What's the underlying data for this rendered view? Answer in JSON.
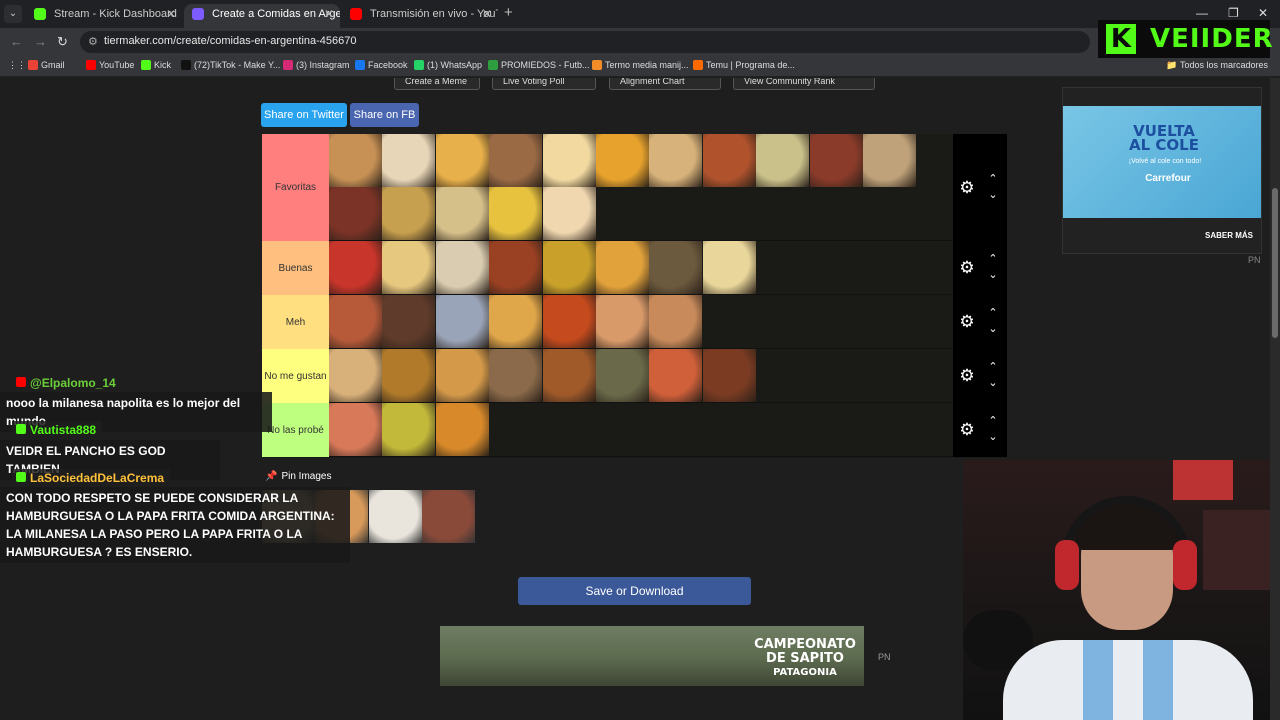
{
  "browser": {
    "tabs": [
      {
        "title": "Stream - Kick Dashboard",
        "color": "#53fc18"
      },
      {
        "title": "Create a Comidas en Argentina",
        "color": "#7c5cff"
      },
      {
        "title": "Transmisión en vivo - YouTube",
        "color": "#ff0000"
      }
    ],
    "url": "tiermaker.com/create/comidas-en-argentina-456670",
    "bookmarks": [
      {
        "label": "Gmail",
        "color": "#ea4335"
      },
      {
        "label": "YouTube",
        "color": "#ff0000"
      },
      {
        "label": "Kick",
        "color": "#53fc18"
      },
      {
        "label": "(72)TikTok - Make Y...",
        "color": "#111111"
      },
      {
        "label": "(3) Instagram",
        "color": "#d62976"
      },
      {
        "label": "Facebook",
        "color": "#1877f2"
      },
      {
        "label": "(1) WhatsApp",
        "color": "#25d366"
      },
      {
        "label": "PROMIEDOS - Futb...",
        "color": "#2e9e3e"
      },
      {
        "label": "Termo media manij...",
        "color": "#f28c28"
      },
      {
        "label": "Temu | Programa de...",
        "color": "#ff6a00"
      }
    ],
    "all_bookmarks": "Todos los marcadores"
  },
  "overlay": {
    "kick_logo_letter": "K",
    "kick_name": "VEIIDER"
  },
  "page": {
    "top_buttons": [
      "Create a Meme",
      "Live Voting Poll",
      "Alignment Chart",
      "View Community Rank"
    ],
    "share_twitter": "Share on Twitter",
    "share_fb": "Share on FB",
    "pin_images": "Pin Images",
    "save": "Save or Download",
    "tiers": [
      {
        "label": "Favoritas",
        "color": "#ff7f7f",
        "items": [
          "#c79155",
          "#e8d6b8",
          "#e8b04a",
          "#9a6a45",
          "#f1d9a0",
          "#e6a22d",
          "#d7b27a",
          "#b0532d",
          "#c9c08a",
          "#8a3b2a",
          "#bfa27a",
          "#7a3326",
          "#c7a04f",
          "#d6c08a",
          "#e7c23f",
          "#f0d7b0"
        ]
      },
      {
        "label": "Buenas",
        "color": "#ffbf7f",
        "items": [
          "#c8352a",
          "#e7c87f",
          "#d9ccb0",
          "#9a4123",
          "#c9a12a",
          "#e2a23b",
          "#6c5a3e",
          "#e9d69a"
        ]
      },
      {
        "label": "Meh",
        "color": "#ffdf7f",
        "items": [
          "#b65a3a",
          "#5e3b2a",
          "#9aa4b8",
          "#e0a64a",
          "#c54a1e",
          "#d99a6a",
          "#c88a5a"
        ]
      },
      {
        "label": "No me gustan",
        "color": "#ffff7f",
        "items": [
          "#d8b07a",
          "#b07a2a",
          "#d49a4a",
          "#8a6a4a",
          "#a05a2a",
          "#6a6a4a",
          "#d0603a",
          "#7a3b22"
        ]
      },
      {
        "label": "No las probé",
        "color": "#bfff7f",
        "items": [
          "#d87a5a",
          "#c2b83a",
          "#d88a2a"
        ]
      }
    ],
    "pool_items": [
      "#bfa57a",
      "#d89a5a",
      "#e9e4dc",
      "#8a4a3a"
    ]
  },
  "ads": {
    "banner_title": "CAMPEONATO DE SAPITO",
    "banner_sub": "PATAGONIA",
    "pn": "PN",
    "side_title": "VUELTA AL COLE",
    "side_sub": "¡Volvé al cole con todo!",
    "side_brand": "Carrefour",
    "side_cta": "SABER MÁS"
  },
  "chat": [
    {
      "user": "@Elpalomo_14",
      "user_color": "#6ccf3a",
      "badge": "#ff0000",
      "message": "nooo la milanesa napolita es lo mejor del mundo"
    },
    {
      "user": "Vautista888",
      "user_color": "#53fc18",
      "badge": "#53fc18",
      "message": "VEIDR EL PANCHO ES GOD TAMBIEN"
    },
    {
      "user": "LaSociedadDeLaCrema",
      "user_color": "#ffc23a",
      "badge": "#53fc18",
      "message": "CON TODO RESPETO SE PUEDE CONSIDERAR LA HAMBURGUESA O LA PAPA FRITA COMIDA ARGENTINA: LA MILANESA LA PASO PERO LA PAPA FRITA O LA HAMBURGUESA ? ES ENSERIO."
    }
  ]
}
